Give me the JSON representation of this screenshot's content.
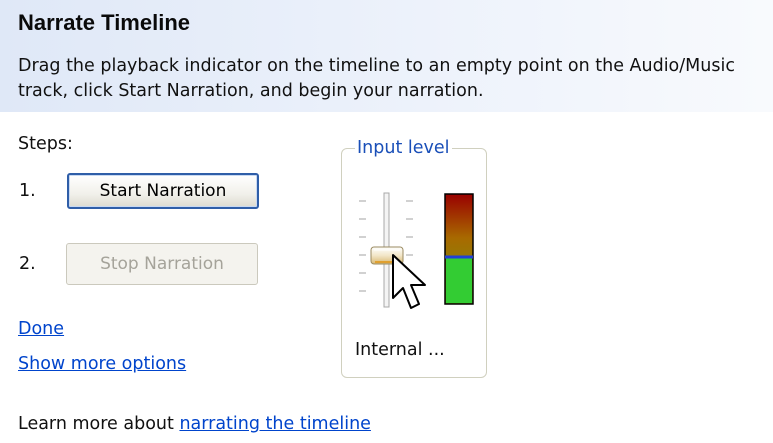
{
  "header": {
    "title": "Narrate Timeline",
    "description": "Drag the playback indicator on the timeline to an empty point on the Audio/Music track, click Start Narration, and begin your narration."
  },
  "steps": {
    "label": "Steps:",
    "items": [
      {
        "number": "1.",
        "button_label": "Start Narration",
        "enabled": true
      },
      {
        "number": "2.",
        "button_label": "Stop Narration",
        "enabled": false
      }
    ]
  },
  "links": {
    "done": "Done",
    "show_more": "Show more options"
  },
  "input_level": {
    "legend": "Input level",
    "device_label": "Internal ...",
    "meter_level": 0.46,
    "slider_level": 0.39
  },
  "footer": {
    "prefix": "Learn more about ",
    "link": "narrating the timeline"
  },
  "colors": {
    "header_bg": "#dfe8f7",
    "link": "#0044cc",
    "legend": "#1a4fb8",
    "meter_green": "#33cc33",
    "meter_red": "#990000",
    "meter_marker": "#1f3fd6"
  },
  "icons": {
    "cursor": "mouse-pointer-icon"
  }
}
